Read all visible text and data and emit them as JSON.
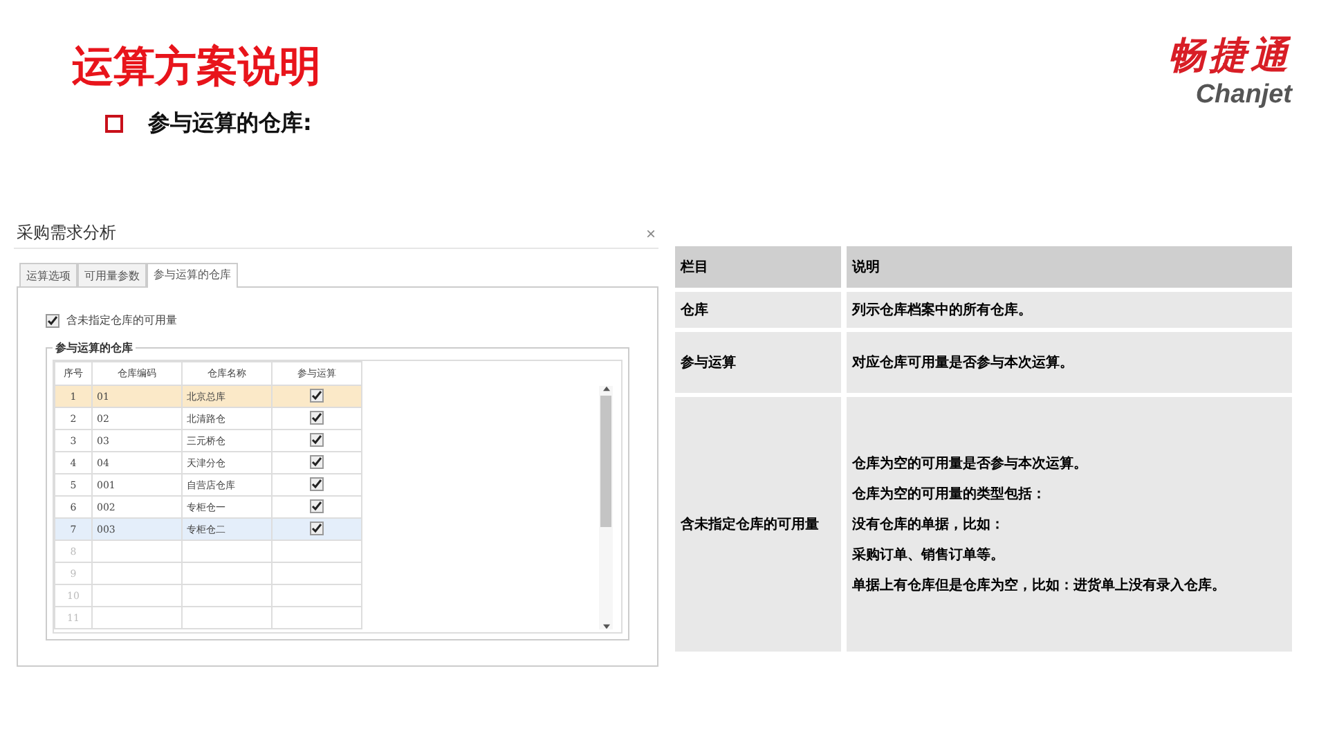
{
  "slide": {
    "title": "运算方案说明",
    "bullet": "参与运算的仓库:"
  },
  "logo": {
    "name": "畅捷通",
    "latin": "Chanjet"
  },
  "dialog": {
    "title": "采购需求分析",
    "close": "×",
    "tabs": [
      {
        "label": "运算选项",
        "selected": false
      },
      {
        "label": "可用量参数",
        "selected": false
      },
      {
        "label": "参与运算的仓库",
        "selected": true
      }
    ],
    "include_unassigned": {
      "label": "含未指定仓库的可用量",
      "checked": true
    },
    "group_title": "参与运算的仓库",
    "columns": [
      "序号",
      "仓库编码",
      "仓库名称",
      "参与运算"
    ],
    "rows": [
      {
        "no": "1",
        "code": "01",
        "name": "北京总库",
        "checked": true,
        "selected": true,
        "hovered": false
      },
      {
        "no": "2",
        "code": "02",
        "name": "北清路仓",
        "checked": true,
        "selected": false,
        "hovered": false
      },
      {
        "no": "3",
        "code": "03",
        "name": "三元桥仓",
        "checked": true,
        "selected": false,
        "hovered": false
      },
      {
        "no": "4",
        "code": "04",
        "name": "天津分仓",
        "checked": true,
        "selected": false,
        "hovered": false
      },
      {
        "no": "5",
        "code": "001",
        "name": "自营店仓库",
        "checked": true,
        "selected": false,
        "hovered": false
      },
      {
        "no": "6",
        "code": "002",
        "name": "专柜仓一",
        "checked": true,
        "selected": false,
        "hovered": false
      },
      {
        "no": "7",
        "code": "003",
        "name": "专柜仓二",
        "checked": true,
        "selected": false,
        "hovered": true
      }
    ],
    "empty_rows": [
      "8",
      "9",
      "10",
      "11"
    ]
  },
  "table": {
    "columns": [
      "栏目",
      "说明"
    ],
    "rows": [
      {
        "field": "仓库",
        "lines": [
          "列示仓库档案中的所有仓库。"
        ]
      },
      {
        "field": "参与运算",
        "lines": [
          "对应仓库可用量是否参与本次运算。"
        ]
      },
      {
        "field": "含未指定仓库的可用量",
        "lines": [
          "仓库为空的可用量是否参与本次运算。",
          "仓库为空的可用量的类型包括：",
          "没有仓库的单据，比如：",
          "采购订单、销售订单等。",
          "单据上有仓库但是仓库为空，比如：进货单上没有录入仓库。"
        ]
      }
    ]
  }
}
